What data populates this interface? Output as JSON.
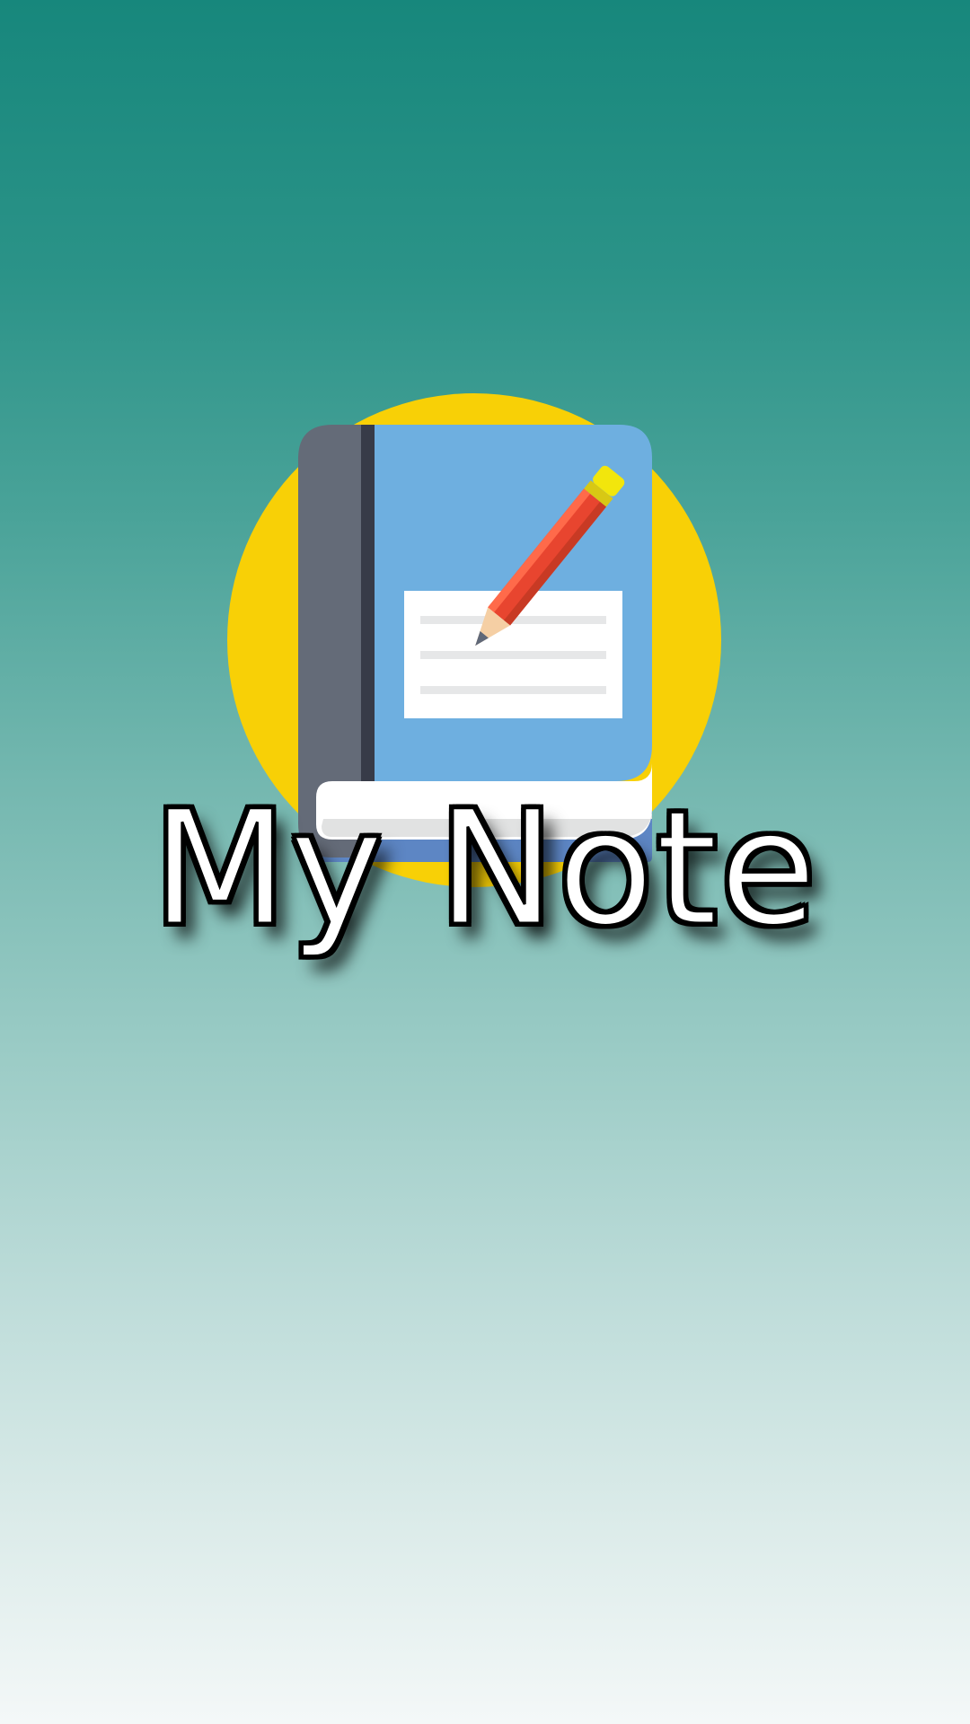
{
  "app": {
    "title": "My Note"
  },
  "icons": {
    "logo": "notebook-with-pencil-icon"
  },
  "colors": {
    "gradient_top": "#17877c",
    "gradient_bottom": "#f4f8f8",
    "circle": "#f8d006",
    "book_cover": "#6eafe0",
    "book_spine": "#646b78",
    "pencil": "#e8452f"
  }
}
